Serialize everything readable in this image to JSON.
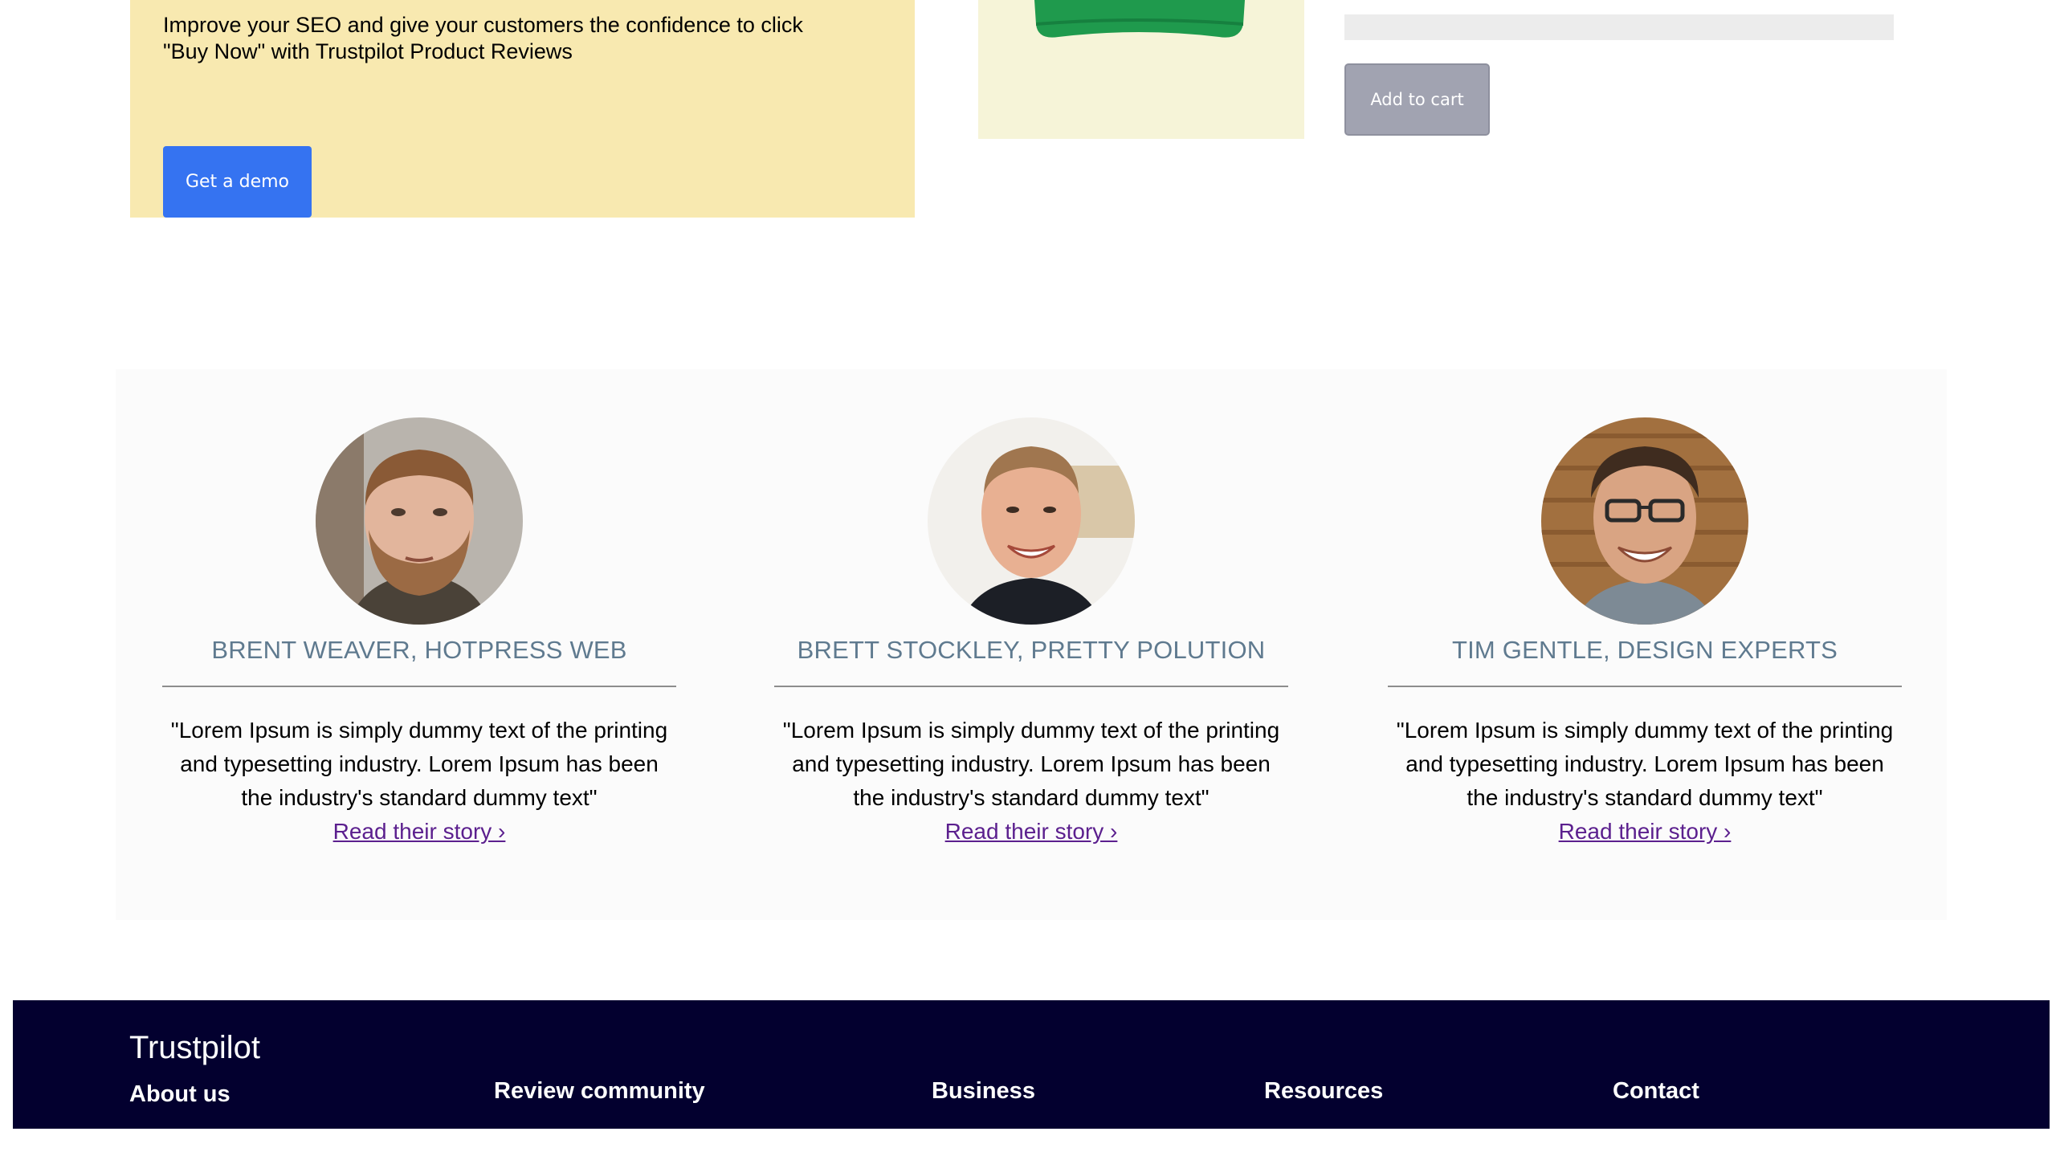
{
  "promo": {
    "text": "Improve your SEO and give your customers the confidence to click \"Buy Now\" with Trustpilot Product Reviews",
    "button_label": "Get a demo"
  },
  "product": {
    "add_to_cart_label": "Add to cart"
  },
  "testimonials": [
    {
      "name": "BRENT WEAVER, HOTPRESS WEB",
      "quote": "\"Lorem Ipsum is simply dummy text of the printing and typesetting industry. Lorem Ipsum has been the industry's standard dummy text\"",
      "link_label": "Read their story ›"
    },
    {
      "name": "BRETT STOCKLEY, PRETTY POLUTION",
      "quote": "\"Lorem Ipsum is simply dummy text of the printing and typesetting industry. Lorem Ipsum has been the industry's standard dummy text\"",
      "link_label": "Read their story ›"
    },
    {
      "name": "TIM GENTLE, DESIGN EXPERTS",
      "quote": "\"Lorem Ipsum is simply dummy text of the printing and typesetting industry. Lorem Ipsum has been the industry's standard dummy text\"",
      "link_label": "Read their story ›"
    }
  ],
  "footer": {
    "logo": "Trustpilot",
    "links": [
      "About us",
      "Review community",
      "Business",
      "Resources",
      "Contact"
    ]
  },
  "colors": {
    "promo_bg": "#f8e9b0",
    "primary_button": "#3573f1",
    "disabled_button": "#a1a3b1",
    "name_text": "#5f7a8f",
    "link": "#5b1f8e",
    "footer_bg": "#03002f"
  }
}
